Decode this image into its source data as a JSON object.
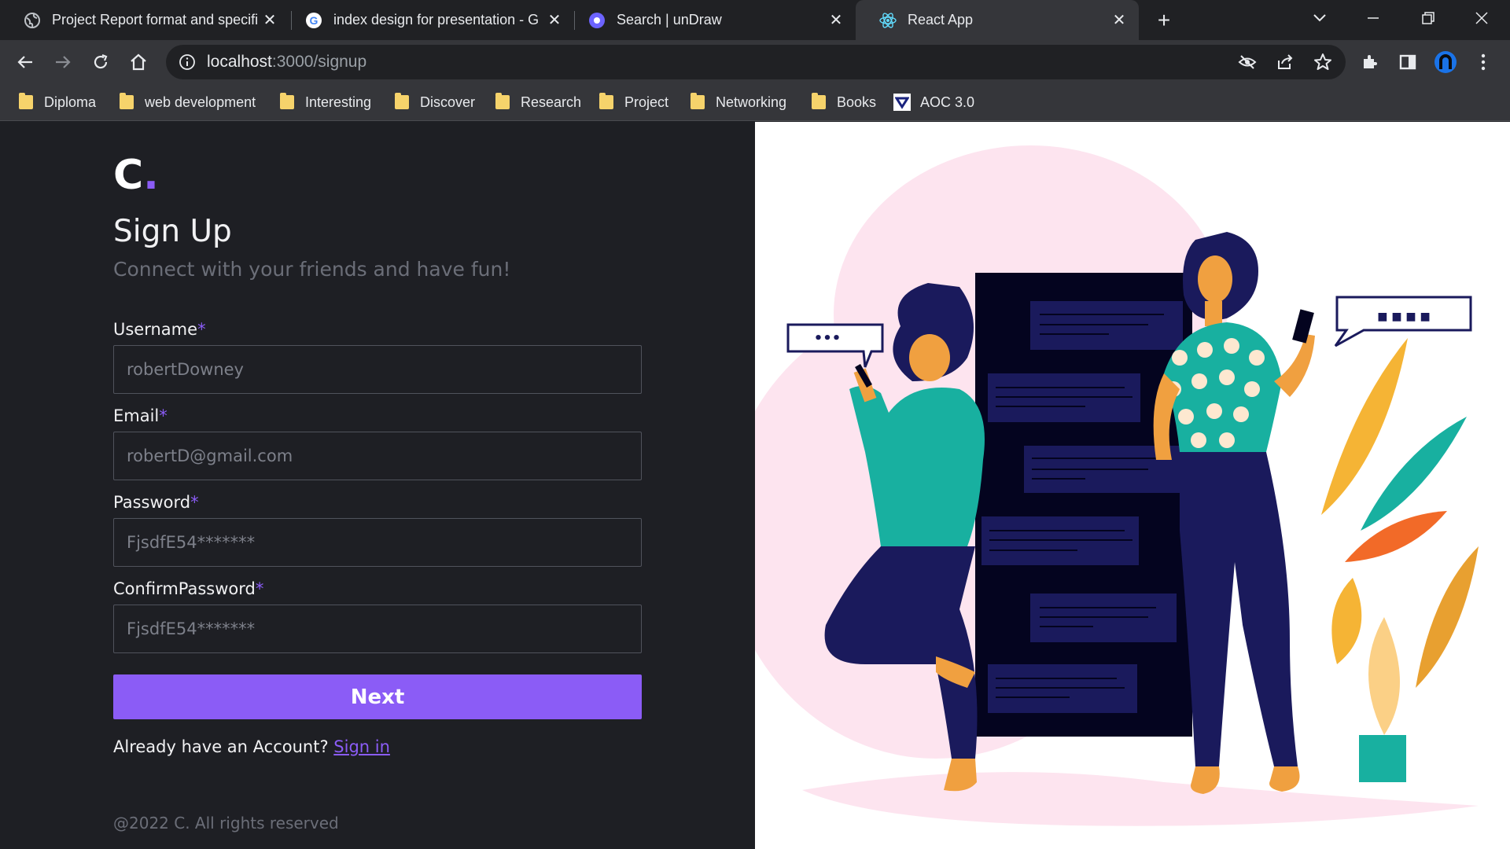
{
  "browser": {
    "tabs": [
      {
        "title": "Project Report format and specifi",
        "icon": "globe-icon",
        "active": false
      },
      {
        "title": "index design for presentation - G",
        "icon": "google-icon",
        "active": false
      },
      {
        "title": "Search | unDraw",
        "icon": "undraw-icon",
        "active": false
      },
      {
        "title": "React App",
        "icon": "react-icon",
        "active": true
      }
    ],
    "url_host": "localhost",
    "url_path": ":3000/signup",
    "bookmarks": [
      {
        "label": "Diploma",
        "icon": "folder-icon"
      },
      {
        "label": "web development",
        "icon": "folder-icon"
      },
      {
        "label": "Interesting",
        "icon": "folder-icon"
      },
      {
        "label": "Discover",
        "icon": "folder-icon"
      },
      {
        "label": "Research",
        "icon": "folder-icon"
      },
      {
        "label": "Project",
        "icon": "folder-icon"
      },
      {
        "label": "Networking",
        "icon": "folder-icon"
      },
      {
        "label": "Books",
        "icon": "folder-icon"
      },
      {
        "label": "AOC 3.0",
        "icon": "aoc-icon"
      }
    ]
  },
  "page": {
    "logo_letter": "C",
    "logo_dot": ".",
    "heading": "Sign Up",
    "subheading": "Connect with your friends and have fun!",
    "required_mark": "*",
    "fields": {
      "username": {
        "label": "Username",
        "placeholder": "robertDowney"
      },
      "email": {
        "label": "Email",
        "placeholder": "robertD@gmail.com"
      },
      "password": {
        "label": "Password",
        "placeholder": "FjsdfE54*******"
      },
      "confirm_password": {
        "label": "ConfirmPassword",
        "placeholder": "FjsdfE54*******"
      }
    },
    "next_label": "Next",
    "already_text": "Already have an Account?",
    "signin_label": "Sign in",
    "footer": "@2022 C. All rights reserved"
  },
  "illustration": {
    "left_bubble": "•••",
    "right_bubble": "■ ■ ■ ■"
  },
  "colors": {
    "accent": "#8b5cf6",
    "page_bg": "#1e1f24",
    "chrome_dark": "#202124",
    "chrome_toolbar": "#35363a"
  }
}
